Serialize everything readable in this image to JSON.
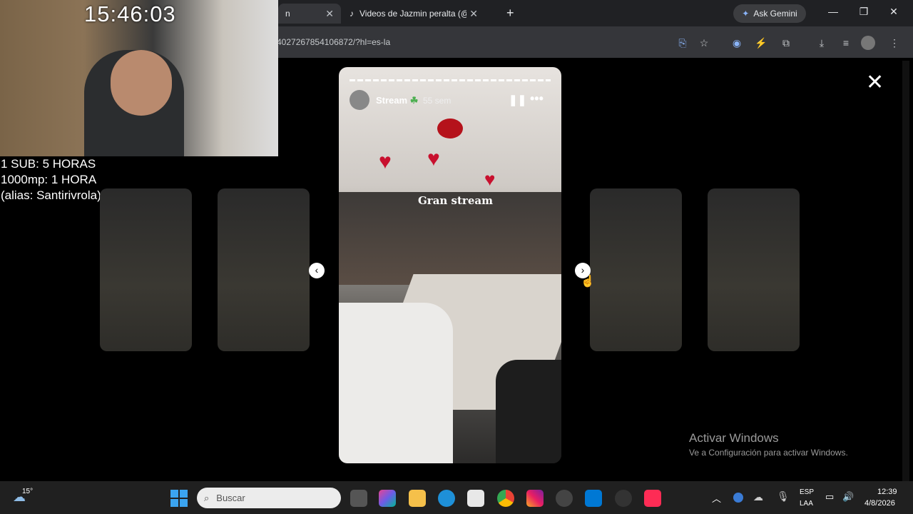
{
  "browser": {
    "tabs": [
      {
        "label": "n"
      },
      {
        "label": "Videos de Jazmin peralta (@jaz..."
      }
    ],
    "new_tab": "+",
    "ask_gemini": "Ask Gemini",
    "url": "4027267854106872/?hl=es-la"
  },
  "webcam_overlay": {
    "clock": "15:46:03",
    "lines": [
      "1 SUB: 5 HORAS",
      "1000mp: 1 HORA",
      "(alias: Santirivrola)"
    ]
  },
  "story": {
    "username": "Stream",
    "badge": "☘",
    "time_ago": "55 sem",
    "caption": "Gran stream"
  },
  "windows": {
    "activate_title": "Activar Windows",
    "activate_sub": "Ve a Configuración para activar Windows."
  },
  "taskbar": {
    "weather_temp": "15°",
    "search_placeholder": "Buscar",
    "lang_top": "ESP",
    "lang_bottom": "LAA",
    "time": "12:39",
    "date": "4/8/2026"
  }
}
